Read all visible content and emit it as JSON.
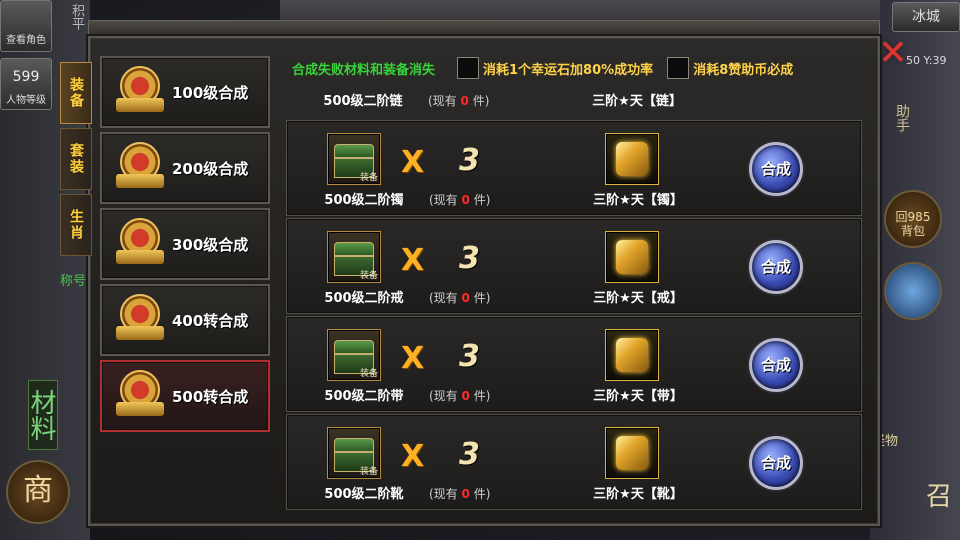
{
  "background": {
    "top_left_labels": [
      "查看角色",
      "人物等级"
    ],
    "level_badge": "599",
    "top_left_side": "积平",
    "map_name": "冰城",
    "coords": "50 Y:39",
    "side_title": "称号",
    "material_vertical": "材料",
    "shop_label": "商",
    "helper_label": "助手",
    "recycle_label": "回985",
    "pack_label": "背包",
    "monster_label": "怪物",
    "summon_label": "召"
  },
  "tabs": [
    {
      "label": "装备",
      "active": true
    },
    {
      "label": "套装",
      "active": false
    },
    {
      "label": "生肖",
      "active": false
    }
  ],
  "levels": [
    {
      "label": "100级合成",
      "active": false
    },
    {
      "label": "200级合成",
      "active": false
    },
    {
      "label": "300级合成",
      "active": false
    },
    {
      "label": "400转合成",
      "active": false
    },
    {
      "label": "500转合成",
      "active": true
    }
  ],
  "options": {
    "fail_notice": "合成失败材料和装备消失",
    "lucky_option": "消耗1个幸运石加80%成功率",
    "sure_option": "消耗8赞助币必成"
  },
  "partial_row": {
    "material": "500级二阶链",
    "have_prefix": "(现有",
    "have_count": "0",
    "have_suffix": "件)",
    "result": "三阶★天【链】"
  },
  "recipes": [
    {
      "material": "500级二阶镯",
      "tag": "装备",
      "mult": "X",
      "qty": "3",
      "have_prefix": "(现有",
      "have_count": "0",
      "have_suffix": "件)",
      "result": "三阶★天【镯】",
      "button": "合成"
    },
    {
      "material": "500级二阶戒",
      "tag": "装备",
      "mult": "X",
      "qty": "3",
      "have_prefix": "(现有",
      "have_count": "0",
      "have_suffix": "件)",
      "result": "三阶★天【戒】",
      "button": "合成"
    },
    {
      "material": "500级二阶带",
      "tag": "装备",
      "mult": "X",
      "qty": "3",
      "have_prefix": "(现有",
      "have_count": "0",
      "have_suffix": "件)",
      "result": "三阶★天【带】",
      "button": "合成"
    },
    {
      "material": "500级二阶靴",
      "tag": "装备",
      "mult": "X",
      "qty": "3",
      "have_prefix": "(现有",
      "have_count": "0",
      "have_suffix": "件)",
      "result": "三阶★天【靴】",
      "button": "合成"
    }
  ],
  "close_glyph": "✕"
}
